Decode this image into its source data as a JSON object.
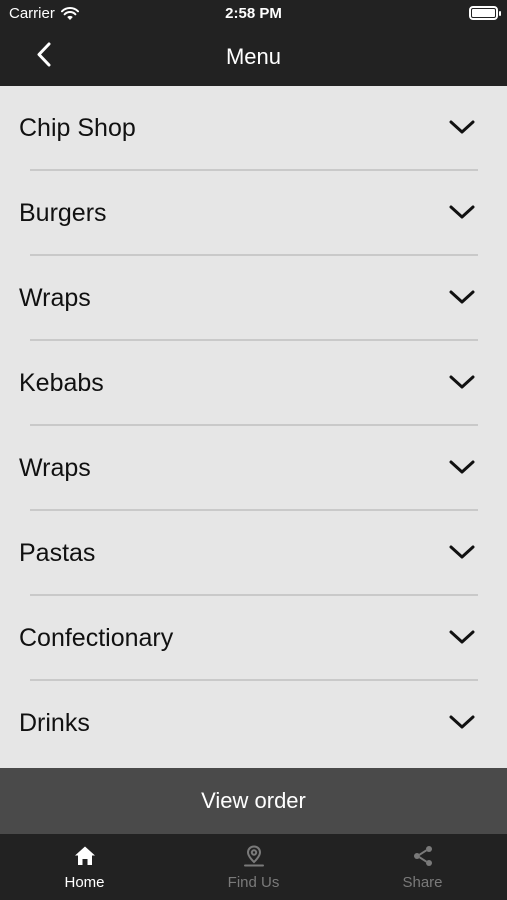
{
  "status_bar": {
    "carrier": "Carrier",
    "time": "2:58 PM"
  },
  "nav": {
    "title": "Menu",
    "back_icon": "chevron-left-icon"
  },
  "menu": {
    "items": [
      {
        "label": "Chip Shop"
      },
      {
        "label": "Burgers"
      },
      {
        "label": "Wraps"
      },
      {
        "label": "Kebabs"
      },
      {
        "label": "Wraps"
      },
      {
        "label": "Pastas"
      },
      {
        "label": "Confectionary"
      },
      {
        "label": "Drinks"
      }
    ]
  },
  "view_order": {
    "label": "View order"
  },
  "tabs": [
    {
      "label": "Home",
      "icon": "home-icon",
      "active": true
    },
    {
      "label": "Find Us",
      "icon": "location-pin-icon",
      "active": false
    },
    {
      "label": "Share",
      "icon": "share-icon",
      "active": false
    }
  ],
  "colors": {
    "bar_dark": "#222222",
    "list_background": "#e6e6e6",
    "view_order_background": "#4a4a4a",
    "inactive_tab": "#7a7a7a"
  }
}
